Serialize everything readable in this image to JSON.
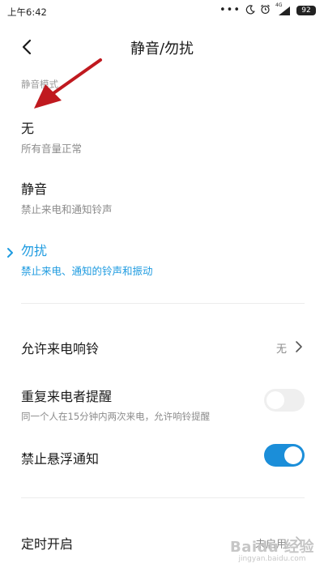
{
  "status_bar": {
    "time": "上午6:42",
    "signal_label": "4G",
    "battery": "92"
  },
  "header": {
    "title": "静音/勿扰"
  },
  "section": {
    "label": "静音模式"
  },
  "modes": [
    {
      "title": "无",
      "subtitle": "所有音量正常",
      "selected": false
    },
    {
      "title": "静音",
      "subtitle": "禁止来电和通知铃声",
      "selected": false
    },
    {
      "title": "勿扰",
      "subtitle": "禁止来电、通知的铃声和振动",
      "selected": true
    }
  ],
  "settings": {
    "allow_calls": {
      "title": "允许来电响铃",
      "value": "无"
    },
    "repeat_callers": {
      "title": "重复来电者提醒",
      "subtitle": "同一个人在15分钟内两次来电，允许响铃提醒",
      "enabled": false
    },
    "block_floating": {
      "title": "禁止悬浮通知",
      "enabled": true
    },
    "schedule": {
      "title": "定时开启",
      "value": "未启用"
    }
  },
  "colors": {
    "accent": "#1e9be0",
    "toggle_on": "#1b8ed9",
    "arrow": "#c0191f"
  },
  "watermark": {
    "brand": "Baidu 经验",
    "site": "jingyan.baidu.com"
  }
}
